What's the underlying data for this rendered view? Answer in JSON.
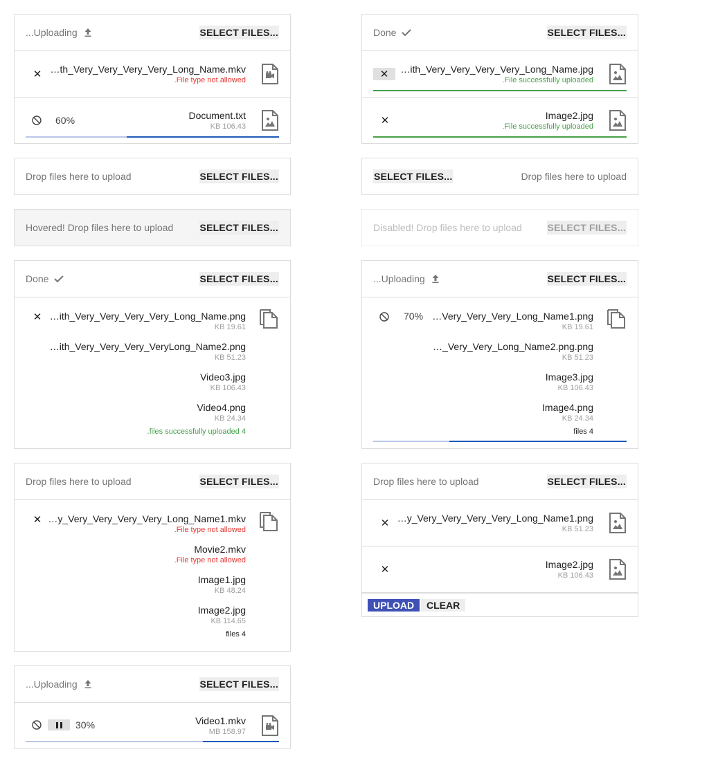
{
  "select_label": "SELECT FILES...",
  "colors": {
    "accent": "#3f51b5",
    "progress": "#1e5ab8",
    "progress_track": "#bbc6e6",
    "success": "#43a047",
    "error": "#e53935"
  },
  "c1": {
    "status": "...Uploading",
    "files": [
      {
        "name": "…th_Very_Very_Very_Very_Long_Name.mkv",
        "error": ".File type not allowed",
        "icon": "video-file-icon"
      },
      {
        "name": "Document.txt",
        "size": "KB 106.43",
        "percent": "60%",
        "progress": 0.6,
        "icon": "image-file-icon"
      }
    ]
  },
  "c2": {
    "status": "Done",
    "files": [
      {
        "name": "…ith_Very_Very_Very_Very_Long_Name.jpg",
        "success": ".File successfully uploaded"
      },
      {
        "name": "Image2.jpg",
        "success": ".File successfully uploaded"
      }
    ]
  },
  "c3": {
    "drop_text": "Drop files here to upload"
  },
  "c4": {
    "drop_text": "Drop files here to upload"
  },
  "c5": {
    "drop_text": "Hovered! Drop files here to upload"
  },
  "c6": {
    "drop_text": "Disabled! Drop files here to upload"
  },
  "c7": {
    "status": "Done",
    "files": [
      {
        "name": "…ith_Very_Very_Very_Very_Long_Name.png",
        "size": "KB 19.61"
      },
      {
        "name": "…ith_Very_Very_Very_VeryLong_Name2.png",
        "size": "KB 51.23"
      },
      {
        "name": "Video3.jpg",
        "size": "KB 106.43"
      },
      {
        "name": "Video4.png",
        "size": "KB 24.34"
      }
    ],
    "summary": ".files successfully uploaded 4"
  },
  "c8": {
    "status": "...Uploading",
    "percent": "70%",
    "progress": 0.7,
    "files": [
      {
        "name": "…Very_Very_Very_Long_Name1.png",
        "size": "KB 19.61"
      },
      {
        "name": "…_Very_Very_Long_Name2.png.png",
        "size": "KB 51.23"
      },
      {
        "name": "Image3.jpg",
        "size": "KB 106.43"
      },
      {
        "name": "Image4.png",
        "size": "KB 24.34"
      }
    ],
    "summary": "files 4"
  },
  "c9": {
    "drop_text": "Drop files here to upload",
    "files": [
      {
        "name": "…y_Very_Very_Very_Very_Long_Name1.mkv",
        "error": ".File type not allowed"
      },
      {
        "name": "Movie2.mkv",
        "error": ".File type not allowed"
      },
      {
        "name": "Image1.jpg",
        "size": "KB 48.24"
      },
      {
        "name": "Image2.jpg",
        "size": "KB 114.65"
      }
    ],
    "summary": "files 4"
  },
  "c10": {
    "drop_text": "Drop files here to upload",
    "files": [
      {
        "name": "…y_Very_Very_Very_Very_Long_Name1.png",
        "size": "KB 51.23"
      },
      {
        "name": "Image2.jpg",
        "size": "KB 106.43"
      }
    ],
    "upload_label": "UPLOAD",
    "clear_label": "CLEAR"
  },
  "c11": {
    "status": "...Uploading",
    "files": [
      {
        "name": "Video1.mkv",
        "size": "MB 158.97",
        "percent": "30%",
        "progress": 0.3
      }
    ]
  }
}
